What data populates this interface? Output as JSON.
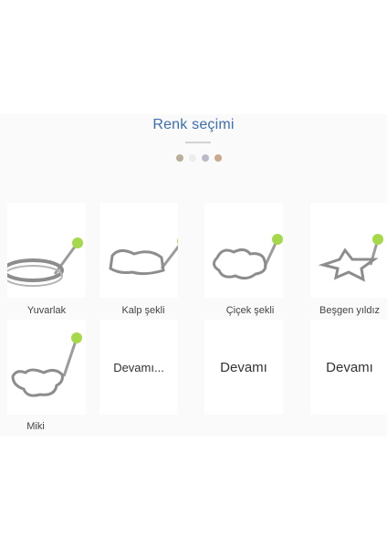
{
  "header": {
    "title": "Renk seçimi"
  },
  "colors": [
    "#b8b09a",
    "#ededed",
    "#b9bcc8",
    "#c9a88e"
  ],
  "accent": "#a6d94a",
  "shapes": [
    {
      "label": "Yuvarlak",
      "icon": "round-ring-icon"
    },
    {
      "label": "Kalp şekli",
      "icon": "heart-ring-icon"
    },
    {
      "label": "Çiçek şekli",
      "icon": "flower-ring-icon"
    },
    {
      "label": "Beşgen yıldız",
      "icon": "star-ring-icon"
    },
    {
      "label": "Miki",
      "icon": "mouse-ring-icon"
    }
  ],
  "more": [
    "Devamı...",
    "Devamı",
    "Devamı"
  ]
}
